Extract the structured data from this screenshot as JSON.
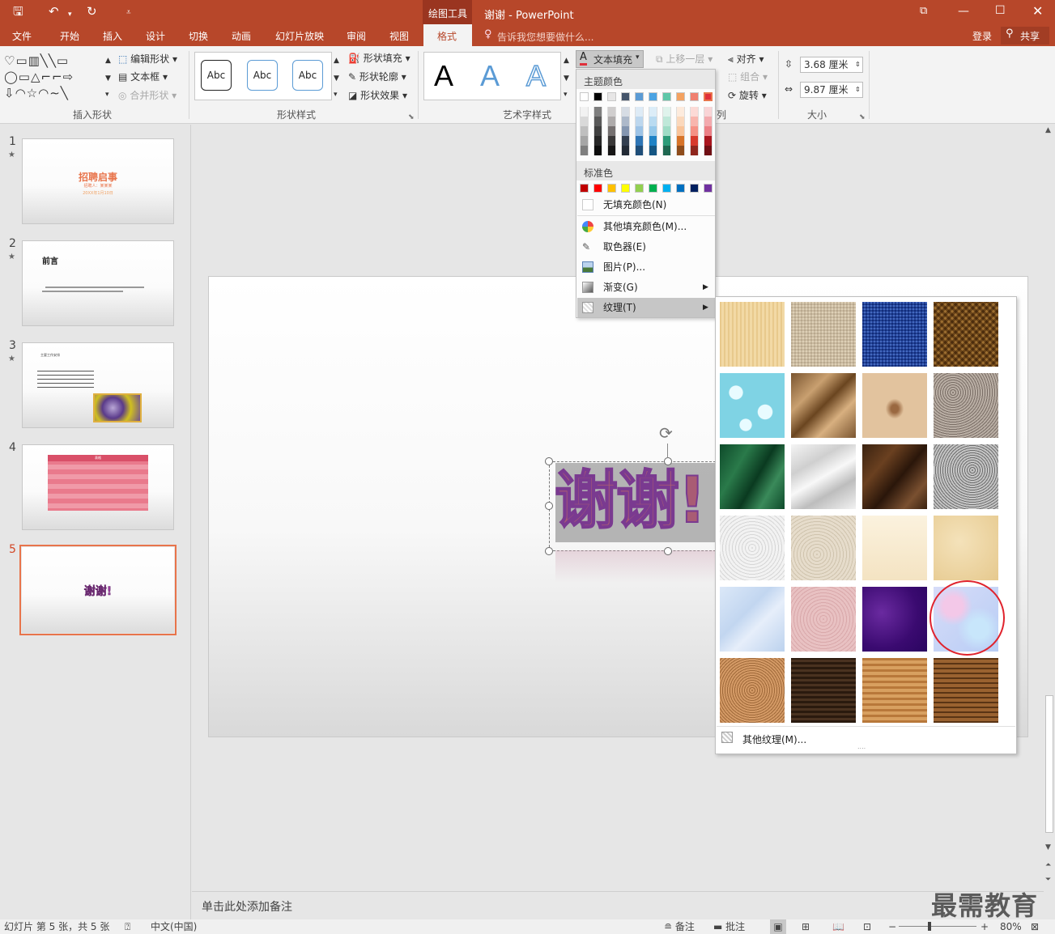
{
  "titlebar": {
    "context_tab": "绘图工具",
    "doc_title": "谢谢 - PowerPoint",
    "qat": {
      "save": "save-icon",
      "undo": "undo-icon",
      "redo": "redo-icon"
    }
  },
  "tabs": [
    "文件",
    "开始",
    "插入",
    "设计",
    "切换",
    "动画",
    "幻灯片放映",
    "审阅",
    "视图",
    "格式"
  ],
  "active_tab": "格式",
  "tell_me": "告诉我您想要做什么...",
  "login": "登录",
  "share": "共享",
  "ribbon": {
    "insert_shapes": {
      "edit_shape": "编辑形状",
      "text_box": "文本框",
      "merge": "合并形状",
      "label": "插入形状"
    },
    "shape_styles": {
      "abc": [
        "Abc",
        "Abc",
        "Abc"
      ],
      "fill": "形状填充",
      "outline": "形状轮廓",
      "effects": "形状效果",
      "label": "形状样式"
    },
    "wordart": {
      "letters": [
        "A",
        "A",
        "A"
      ],
      "text_fill": "文本填充",
      "label": "艺术字样式"
    },
    "arrange": {
      "bring_forward": "上移一层",
      "align": "对齐",
      "group": "组合",
      "rotate": "旋转",
      "label": "列"
    },
    "size": {
      "height": "3.68 厘米",
      "width": "9.87 厘米",
      "label": "大小"
    }
  },
  "slides": [
    {
      "num": "1",
      "star": "★",
      "title": "招聘启事",
      "sub": "招聘人：某某某",
      "date": "20XX年1月10日"
    },
    {
      "num": "2",
      "star": "★",
      "title": "前言"
    },
    {
      "num": "3",
      "star": "★",
      "title": "主要工作安排"
    },
    {
      "num": "4",
      "star": "",
      "title": "表格"
    },
    {
      "num": "5",
      "star": "",
      "title": "谢谢!"
    }
  ],
  "main_slide": {
    "wordart": "谢谢!"
  },
  "notes": "单击此处添加备注",
  "text_fill_menu": {
    "theme_colors": "主题颜色",
    "standard_colors": "标准色",
    "no_fill": "无填充颜色(N)",
    "more_colors": "其他填充颜色(M)...",
    "eyedropper": "取色器(E)",
    "picture": "图片(P)...",
    "gradient": "渐变(G)",
    "texture": "纹理(T)"
  },
  "theme_palette_top": [
    "#ffffff",
    "#000000",
    "#e7e6e6",
    "#44546a",
    "#5b9bd5",
    "#4ba3e3",
    "#5fc7a8",
    "#f4a261",
    "#f08070",
    "#e0303a"
  ],
  "standard_palette": [
    "#c00000",
    "#ff0000",
    "#ffc000",
    "#ffff00",
    "#92d050",
    "#00b050",
    "#00b0f0",
    "#0070c0",
    "#002060",
    "#7030a0"
  ],
  "texture_panel": {
    "more_textures": "其他纹理(M)...",
    "selected": "花束"
  },
  "statusbar": {
    "slide_info": "幻灯片 第 5 张，共 5 张",
    "lang": "中文(中国)",
    "notes": "备注",
    "comments": "批注",
    "zoom": "80%"
  },
  "watermark": "最需教育"
}
